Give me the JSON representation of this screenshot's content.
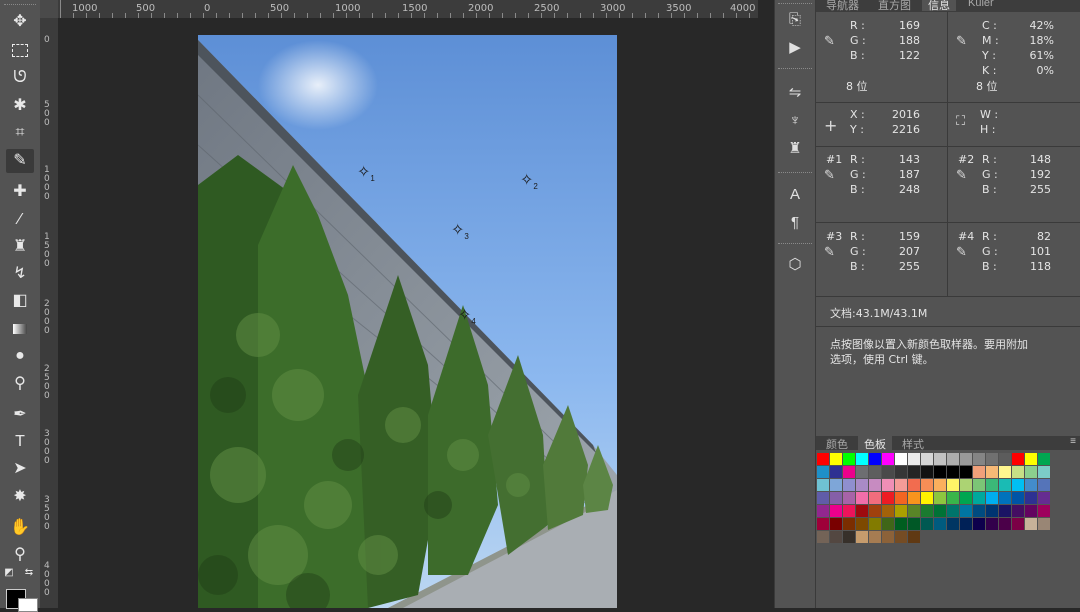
{
  "ruler": {
    "top_labels": [
      "1000",
      "500",
      "0",
      "500",
      "1000",
      "1500",
      "2000",
      "2500",
      "3000",
      "3500",
      "4000"
    ],
    "left_labels": [
      "0",
      "500",
      "1000",
      "1500",
      "2000",
      "2500",
      "3000",
      "3500",
      "4000"
    ]
  },
  "canvas": {
    "sampler_markers": [
      "1",
      "2",
      "3",
      "4"
    ]
  },
  "panel": {
    "tabs": [
      "导航器",
      "直方图",
      "信息",
      "Kuler"
    ],
    "active_tab": "信息",
    "rgb": {
      "r_label": "R :",
      "g_label": "G :",
      "b_label": "B :",
      "r": "169",
      "g": "188",
      "b": "122",
      "bits": "8 位"
    },
    "cmyk": {
      "c_label": "C :",
      "m_label": "M :",
      "y_label": "Y :",
      "k_label": "K :",
      "c": "42%",
      "m": "18%",
      "y": "61%",
      "k": "0%",
      "bits": "8 位"
    },
    "pos": {
      "x_label": "X :",
      "y_label": "Y :",
      "x": "2016",
      "y": "2216"
    },
    "size": {
      "w_label": "W :",
      "h_label": "H :"
    },
    "samplers": [
      {
        "id": "#1",
        "r": "143",
        "g": "187",
        "b": "248"
      },
      {
        "id": "#2",
        "r": "148",
        "g": "192",
        "b": "255"
      },
      {
        "id": "#3",
        "r": "159",
        "g": "207",
        "b": "255"
      },
      {
        "id": "#4",
        "r": "82",
        "g": "101",
        "b": "118"
      }
    ],
    "doc_size": "文档:43.1M/43.1M",
    "hint_line1": "点按图像以置入新颜色取样器。要用附加",
    "hint_line2": "选项，使用  Ctrl 键。"
  },
  "swatch_panel": {
    "tabs": [
      "颜色",
      "色板",
      "样式"
    ],
    "active_tab": "色板",
    "colors": [
      [
        "#ff0000",
        "#ffff00",
        "#00ff00",
        "#00ffff",
        "#0000ff",
        "#ff00ff",
        "#ffffff",
        "#ebebeb",
        "#d6d6d6",
        "#c2c2c2",
        "#adadad",
        "#999999",
        "#858585",
        "#707070",
        "#5c5c5c",
        "#ff0000",
        "#ffff00",
        "#00a651"
      ],
      [
        "#1e90c8",
        "#2e3192",
        "#ec008c",
        "#6d6e71",
        "#5e5e5e",
        "#4a4a4a",
        "#363636",
        "#242424",
        "#121212",
        "#000000",
        "#000000",
        "#000000",
        "#f0a07a",
        "#f7b976",
        "#fff68f",
        "#c7df86",
        "#8ccf8e",
        "#7cccc8"
      ],
      [
        "#6fc2d3",
        "#7ea6d8",
        "#8f8fcf",
        "#a98bc6",
        "#c78bc1",
        "#ef8fb6",
        "#f49c97",
        "#f26c4f",
        "#f68e56",
        "#fbaf5d",
        "#fff467",
        "#acd373",
        "#7cc576",
        "#3bb878",
        "#1abbb4",
        "#00bff3",
        "#438ccb",
        "#5574b9"
      ],
      [
        "#605ca8",
        "#855fa8",
        "#a763a8",
        "#f06eaa",
        "#f26d7d",
        "#ed1c24",
        "#f26522",
        "#f7941d",
        "#fff200",
        "#8dc63f",
        "#39b54a",
        "#00a651",
        "#00a99d",
        "#00aeef",
        "#0072bc",
        "#0054a6",
        "#2e3192",
        "#662d91"
      ],
      [
        "#92278f",
        "#ec008c",
        "#ed145b",
        "#9e0b0f",
        "#a0410d",
        "#a3620a",
        "#aba000",
        "#598527",
        "#1a7b30",
        "#007236",
        "#00746b",
        "#0076a3",
        "#004b80",
        "#003471",
        "#1b1464",
        "#440e62",
        "#630460",
        "#9e005d"
      ],
      [
        "#9e0039",
        "#790000",
        "#7b2e00",
        "#7d4900",
        "#827b00",
        "#406618",
        "#005e20",
        "#005826",
        "#005952",
        "#005b7f",
        "#003663",
        "#002157",
        "#0d004c",
        "#32004b",
        "#4b0049",
        "#7b0046",
        "#c7b299",
        "#998675"
      ],
      [
        "#736357",
        "#534741",
        "#37302a",
        "#c69c6d",
        "#a67c52",
        "#8c6239",
        "#754c24",
        "#603913"
      ]
    ]
  }
}
